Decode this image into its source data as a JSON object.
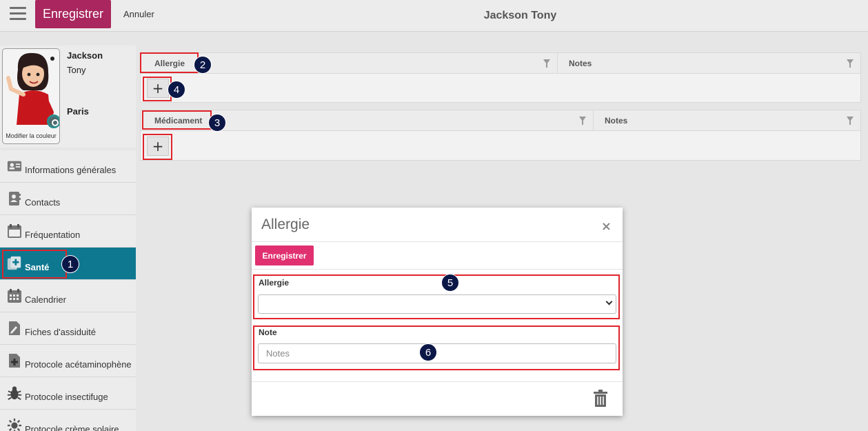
{
  "topbar": {
    "save_label": "Enregistrer",
    "cancel_label": "Annuler",
    "title": "Jackson Tony"
  },
  "profile": {
    "first_name": "Jackson",
    "last_name": "Tony",
    "city": "Paris",
    "avatar_caption": "Modifier la couleur"
  },
  "sidebar": {
    "items": [
      {
        "label": "Informations générales",
        "icon": "id-card-icon"
      },
      {
        "label": "Contacts",
        "icon": "contacts-icon"
      },
      {
        "label": "Fréquentation",
        "icon": "calendar-frame-icon"
      },
      {
        "label": "Santé",
        "icon": "health-icon"
      },
      {
        "label": "Calendrier",
        "icon": "calendar-icon"
      },
      {
        "label": "Fiches d'assiduité",
        "icon": "edit-file-icon"
      },
      {
        "label": "Protocole acétaminophène",
        "icon": "medical-file-icon"
      },
      {
        "label": "Protocole insectifuge",
        "icon": "bug-icon"
      },
      {
        "label": "Protocole crème solaire",
        "icon": "sun-icon"
      }
    ]
  },
  "allergy_grid": {
    "col1": "Allergie",
    "col2": "Notes",
    "add_label": "+"
  },
  "medication_grid": {
    "col1": "Médicament",
    "col2": "Notes",
    "add_label": "+"
  },
  "markers": [
    "1",
    "2",
    "3",
    "4",
    "5",
    "6"
  ],
  "modal": {
    "title": "Allergie",
    "close_label": "×",
    "save_label": "Enregistrer",
    "allergy_label": "Allergie",
    "allergy_value": "",
    "note_label": "Note",
    "note_placeholder": "Notes"
  },
  "colors": {
    "brand": "#a9265e",
    "modal_save": "#e0306f",
    "active_nav": "#0f7891",
    "highlight": "#e0242a",
    "marker": "#0b1747"
  }
}
